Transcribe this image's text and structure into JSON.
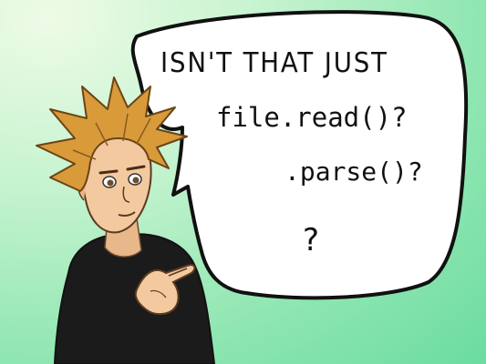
{
  "speech_bubble": {
    "line1": "ISN'T THAT JUST",
    "line2": "file.read()?",
    "line3": ".parse()?",
    "line4": "?"
  },
  "colors": {
    "background": "#8fe6b1",
    "bubble_fill": "#ffffff",
    "outline": "#111111",
    "hair": "#d99a3a",
    "skin": "#f3c9a0",
    "shirt": "#1a1a1a"
  }
}
